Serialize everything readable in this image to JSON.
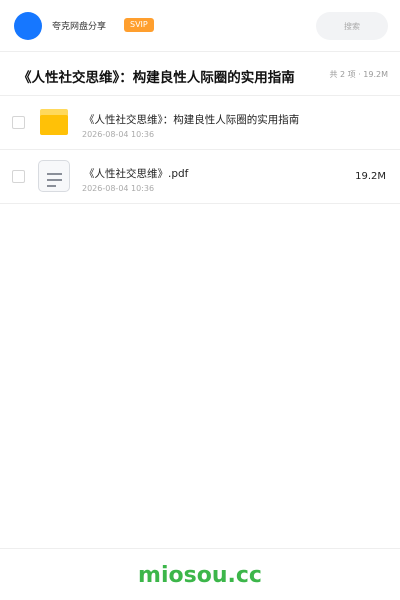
{
  "header": {
    "brand": "夸克网盘分享",
    "badge": "SVIP",
    "search_placeholder": "搜索"
  },
  "folder": {
    "title": "《人性社交思维》：构建良性人际圈的实用指南",
    "meta": "共 2 项 · 19.2M"
  },
  "files": [
    {
      "name": "《人性社交思维》：构建良性人际圈的实用指南",
      "date": "2026-08-04 10:36",
      "size": "",
      "icon": "folder-icon"
    },
    {
      "name": "《人性社交思维》.pdf",
      "date": "2026-08-04 10:36",
      "size": "19.2M",
      "icon": "file-icon"
    }
  ],
  "footer": {
    "logo": "miosou.cc"
  },
  "colors": {
    "accent": "#1677ff",
    "badge": "#ff9f2e",
    "folder": "#ffc107",
    "logo": "#3cb64a"
  }
}
